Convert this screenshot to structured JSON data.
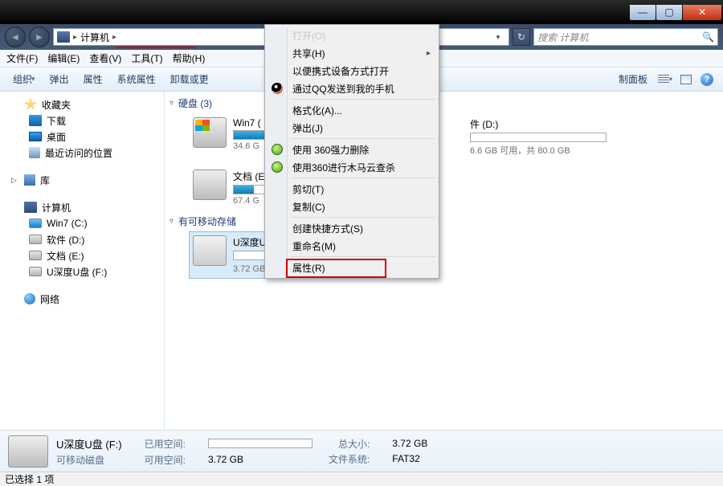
{
  "titlebar": {
    "min": "—",
    "max": "▢",
    "close": "✕"
  },
  "nav": {
    "address_icon_text": "",
    "address_text": "计算机",
    "arrow": "▸",
    "search_placeholder": "搜索 计算机"
  },
  "menubar": [
    "文件(F)",
    "编辑(E)",
    "查看(V)",
    "工具(T)",
    "帮助(H)"
  ],
  "toolbar": {
    "organize": "组织",
    "eject": "弹出",
    "properties": "属性",
    "sysprops": "系统属性",
    "uninstall": "卸载或更",
    "ctrlpanel": "制面板"
  },
  "sidebar": {
    "favorites": {
      "title": "收藏夹",
      "items": [
        "下载",
        "桌面",
        "最近访问的位置"
      ]
    },
    "libraries": {
      "title": "库"
    },
    "computer": {
      "title": "计算机",
      "items": [
        "Win7 (C:)",
        "软件 (D:)",
        "文档 (E:)",
        "U深度U盘 (F:)"
      ]
    },
    "network": {
      "title": "网络"
    }
  },
  "content": {
    "hdd_header": "硬盘 (3)",
    "removable_header": "有可移动存储",
    "drives": {
      "c": {
        "name": "Win7 (",
        "sub": "34.6 G",
        "fill": 50
      },
      "d": {
        "name": "件 (D:)",
        "sub": "6.6 GB 可用，共 80.0 GB",
        "fill": 0
      },
      "e": {
        "name": "文档 (E",
        "sub": "67.4 G",
        "fill": 15
      },
      "f": {
        "name": "U深度U",
        "sub": "3.72 GB 可用，共 3.72 GB",
        "fill": 0
      }
    }
  },
  "ctx": {
    "items": [
      {
        "label": "共享(H)",
        "sub": true
      },
      {
        "label": "以便携式设备方式打开"
      },
      {
        "label": "通过QQ发送到我的手机",
        "icon": "qq"
      },
      {
        "sep": true
      },
      {
        "label": "格式化(A)..."
      },
      {
        "label": "弹出(J)"
      },
      {
        "sep": true
      },
      {
        "label": "使用 360强力删除",
        "icon": "g360"
      },
      {
        "label": "使用360进行木马云查杀",
        "icon": "g360"
      },
      {
        "sep": true
      },
      {
        "label": "剪切(T)"
      },
      {
        "label": "复制(C)"
      },
      {
        "sep": true
      },
      {
        "label": "创建快捷方式(S)"
      },
      {
        "label": "重命名(M)"
      },
      {
        "sep": true
      },
      {
        "label": "属性(R)"
      }
    ],
    "top_disabled": "打开(O)"
  },
  "details": {
    "name": "U深度U盘 (F:)",
    "type": "可移动磁盘",
    "used_label": "已用空间:",
    "free_label": "可用空间:",
    "free_value": "3.72 GB",
    "total_label": "总大小:",
    "total_value": "3.72 GB",
    "fs_label": "文件系统:",
    "fs_value": "FAT32"
  },
  "status": "已选择 1 项"
}
